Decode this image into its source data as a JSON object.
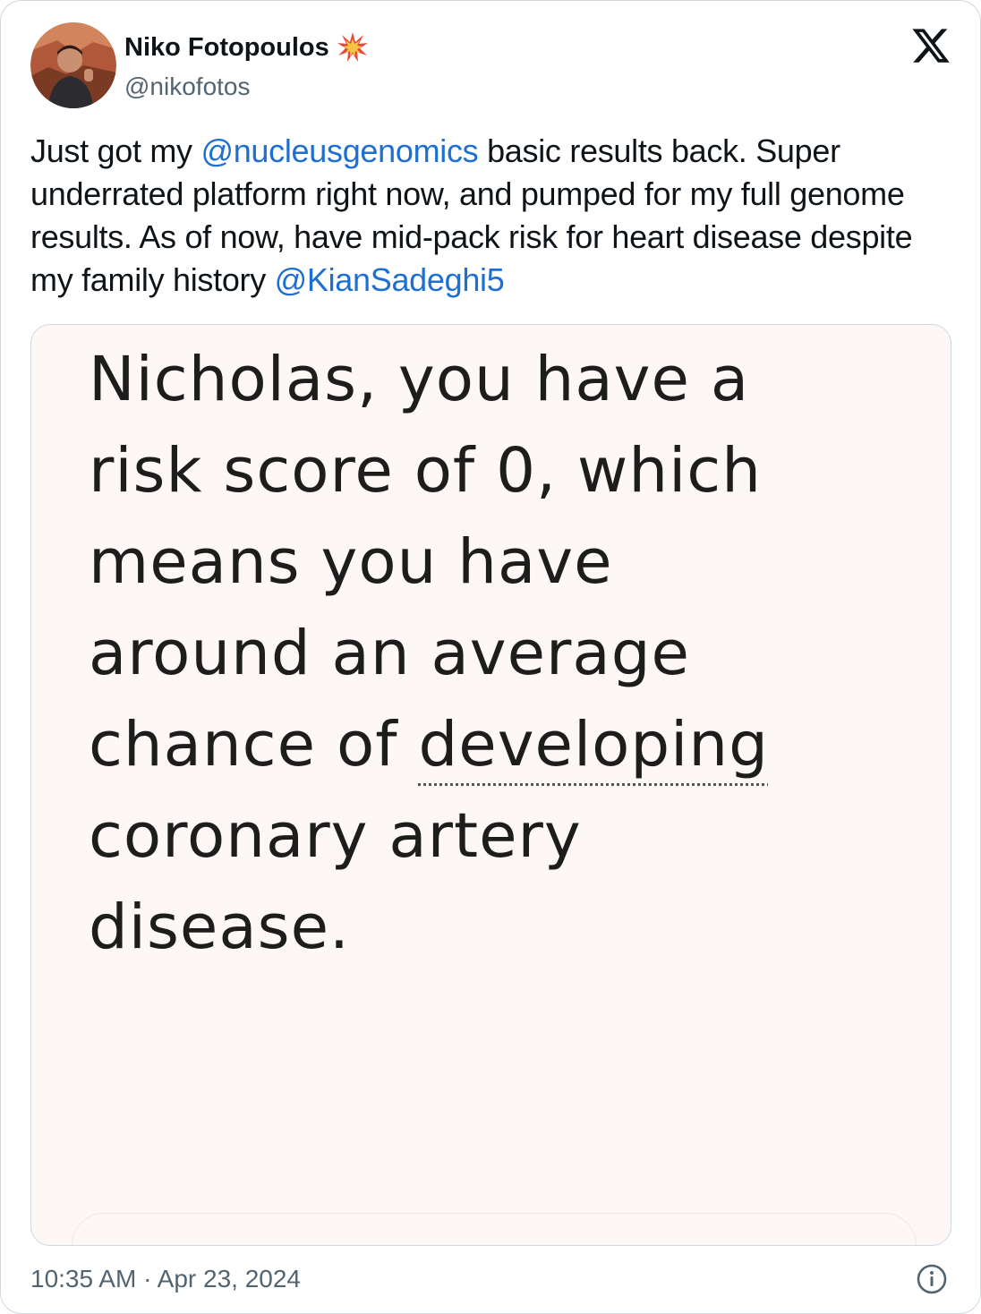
{
  "author": {
    "name": "Niko Fotopoulos",
    "handle": "@nikofotos",
    "avatar_icon": "profile-photo-avatar",
    "badge_icon": "sparkle-burst-emoji"
  },
  "platform": {
    "logo_icon": "x-logo-icon"
  },
  "tweet": {
    "text_1": "Just got my ",
    "mention_1": "@nucleusgenomics",
    "text_2": " basic results back. Super underrated platform right now, and pumped for my full genome results. As of now, have mid-pack risk for heart disease despite my family history ",
    "mention_2": "@KianSadeghi5"
  },
  "media": {
    "line_1": "Nicholas, you have a",
    "line_2": "risk score of 0, which",
    "line_3": "means you have",
    "line_4": "around an average",
    "line_5_a": "chance of ",
    "line_5_b": "developing",
    "line_6": "coronary artery",
    "line_7": "disease."
  },
  "footer": {
    "timestamp": "10:35 AM · Apr 23, 2024",
    "info_icon": "info-circle-icon"
  },
  "colors": {
    "link": "#1d6fd1",
    "secondary_text": "#536471",
    "border": "#cfd9de",
    "media_background": "#fdf7f5"
  }
}
